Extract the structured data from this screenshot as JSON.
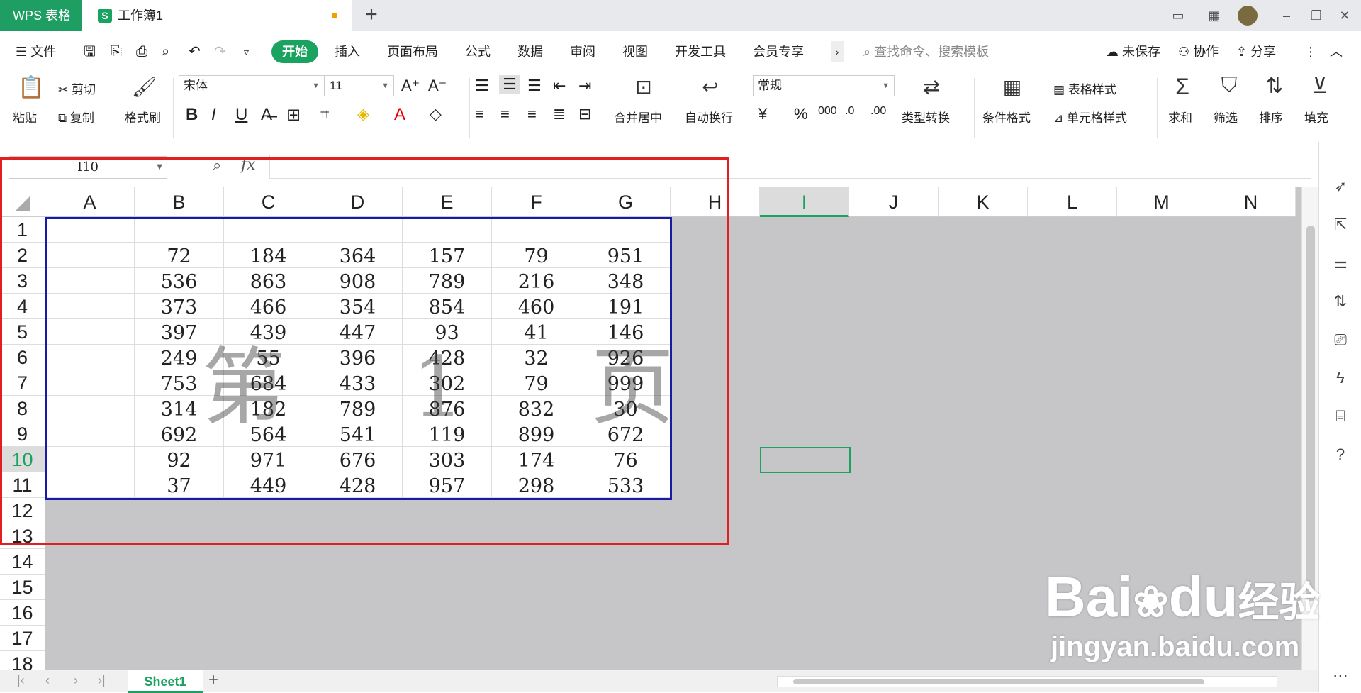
{
  "titlebar": {
    "app_tab": "WPS 表格",
    "doc_tab": "工作簿1",
    "new_tab": "+"
  },
  "menubar": {
    "file": "文件",
    "tabs": [
      "开始",
      "插入",
      "页面布局",
      "公式",
      "数据",
      "审阅",
      "视图",
      "开发工具",
      "会员专享"
    ],
    "search_placeholder": "查找命令、搜索模板",
    "unsaved": "未保存",
    "collab": "协作",
    "share": "分享"
  },
  "ribbon": {
    "paste": "粘贴",
    "cut": "剪切",
    "copy": "复制",
    "format_painter": "格式刷",
    "font_name": "宋体",
    "font_size": "11",
    "merge_center": "合并居中",
    "wrap_text": "自动换行",
    "number_format": "常规",
    "type_convert": "类型转换",
    "cond_format": "条件格式",
    "table_style": "表格样式",
    "cell_style": "单元格样式",
    "sum": "求和",
    "filter": "筛选",
    "sort": "排序",
    "fill": "填充"
  },
  "formula": {
    "name_box": "I10",
    "fx": "fx",
    "value": ""
  },
  "grid": {
    "columns": [
      "A",
      "B",
      "C",
      "D",
      "E",
      "F",
      "G",
      "H",
      "I",
      "J",
      "K",
      "L",
      "M",
      "N"
    ],
    "rows": [
      "1",
      "2",
      "3",
      "4",
      "5",
      "6",
      "7",
      "8",
      "9",
      "10",
      "11",
      "12",
      "13",
      "14",
      "15",
      "16",
      "17",
      "18"
    ],
    "data": [
      [
        "",
        "",
        "",
        "",
        "",
        "",
        ""
      ],
      [
        "",
        "72",
        "184",
        "364",
        "157",
        "79",
        "951"
      ],
      [
        "",
        "536",
        "863",
        "908",
        "789",
        "216",
        "348"
      ],
      [
        "",
        "373",
        "466",
        "354",
        "854",
        "460",
        "191"
      ],
      [
        "",
        "397",
        "439",
        "447",
        "93",
        "41",
        "146"
      ],
      [
        "",
        "249",
        "55",
        "396",
        "428",
        "32",
        "926"
      ],
      [
        "",
        "753",
        "684",
        "433",
        "302",
        "79",
        "999"
      ],
      [
        "",
        "314",
        "182",
        "789",
        "876",
        "832",
        "30"
      ],
      [
        "",
        "692",
        "564",
        "541",
        "119",
        "899",
        "672"
      ],
      [
        "",
        "92",
        "971",
        "676",
        "303",
        "174",
        "76"
      ],
      [
        "",
        "37",
        "449",
        "428",
        "957",
        "298",
        "533"
      ]
    ],
    "selected_cell": "I10",
    "watermark": "第 1 页"
  },
  "sheets": {
    "active": "Sheet1",
    "add": "+"
  },
  "overlay": {
    "brand": "Bai",
    "brand_du": "du",
    "brand_cn": "经验",
    "url": "jingyan.baidu.com"
  },
  "colors": {
    "accent": "#1aa260",
    "print_area": "#1a1aa8",
    "highlight": "#e02020",
    "page_break_bg": "#c6c5c8"
  }
}
